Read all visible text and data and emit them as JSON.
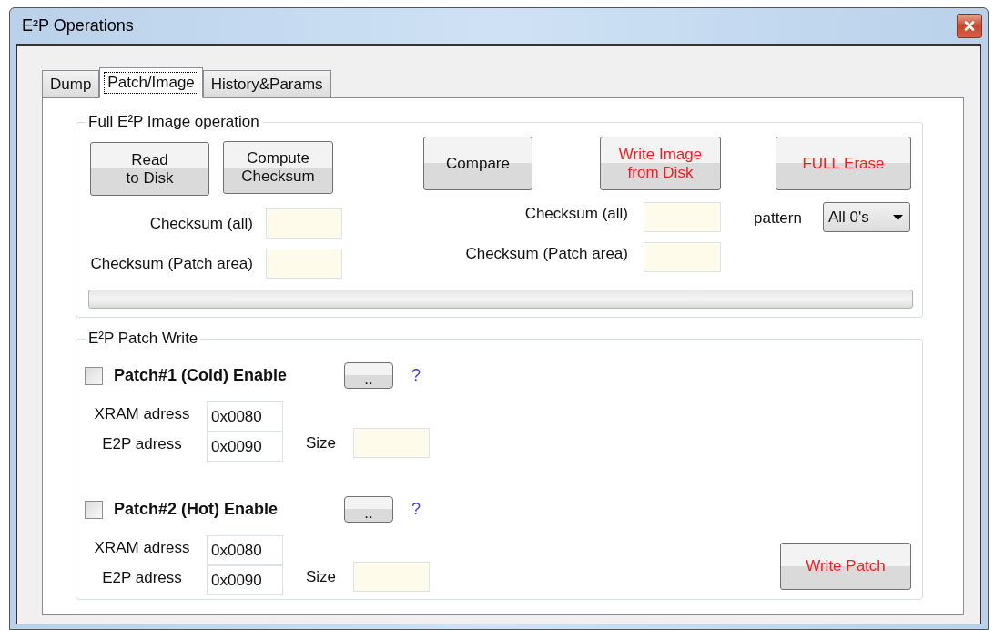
{
  "window": {
    "title": "E²P Operations"
  },
  "tabs": [
    {
      "label": "Dump",
      "selected": false
    },
    {
      "label": "Patch/Image",
      "selected": true
    },
    {
      "label": "History&Params",
      "selected": false
    }
  ],
  "image_group": {
    "title": "Full E²P Image operation",
    "buttons": [
      {
        "label": "Read\nto Disk",
        "kind": "normal"
      },
      {
        "label": "Compute\nChecksum",
        "kind": "normal"
      },
      {
        "label": "Compare",
        "kind": "normal"
      },
      {
        "label": "Write Image\nfrom Disk",
        "kind": "warning"
      },
      {
        "label": "FULL Erase",
        "kind": "warning"
      }
    ],
    "left_checksums": [
      {
        "label": "Checksum (all)"
      },
      {
        "label": "Checksum (Patch area)"
      }
    ],
    "right_checksums": [
      {
        "label": "Checksum (all)"
      },
      {
        "label": "Checksum (Patch area)"
      }
    ],
    "pattern": {
      "label": "pattern",
      "value": "All 0's"
    },
    "progress": {
      "level": 0
    }
  },
  "patch_group": {
    "title": "E²P Patch Write",
    "patches": [
      {
        "label": "Patch#1 (Cold) Enable",
        "checked": false,
        "browse": "..",
        "help": "?",
        "xram_label": "XRAM adress",
        "xram": "0x0080",
        "e2p_label": "E2P adress",
        "e2p": "0x0090",
        "size_label": "Size"
      },
      {
        "label": "Patch#2 (Hot) Enable",
        "checked": false,
        "browse": "..",
        "help": "?",
        "xram_label": "XRAM adress",
        "xram": "0x0080",
        "e2p_label": "E2P adress",
        "e2p": "0x0090",
        "size_label": "Size"
      }
    ],
    "write_button": "Write Patch"
  }
}
